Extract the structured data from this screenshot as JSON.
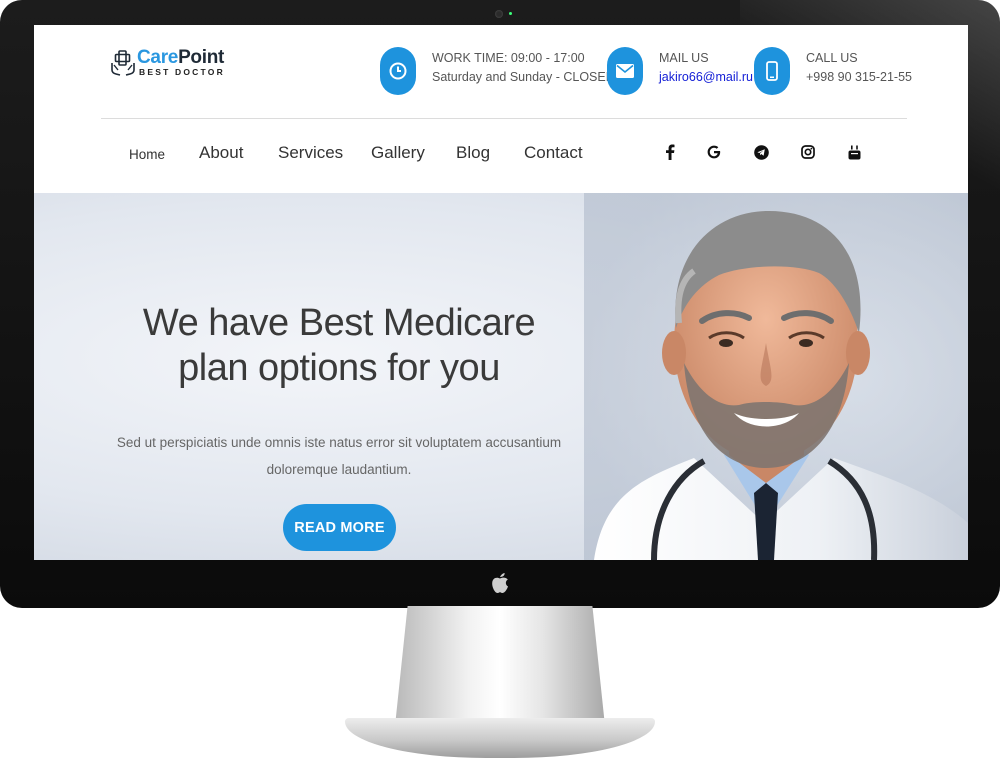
{
  "brand": {
    "name_part1": "Care",
    "name_part2": "Point",
    "tagline": "BEST DOCTOR",
    "accent_color": "#1e93dd"
  },
  "header": {
    "work": {
      "icon": "clock-icon",
      "title": "WORK TIME: 09:00 - 17:00",
      "value": "Saturday and Sunday - CLOSED"
    },
    "mail": {
      "icon": "mail-icon",
      "title": "MAIL US",
      "value": "jakiro66@mail.ru"
    },
    "call": {
      "icon": "phone-icon",
      "title": "CALL US",
      "value": "+998 90 315-21-55"
    }
  },
  "nav": {
    "items": [
      "Home",
      "About",
      "Services",
      "Gallery",
      "Blog",
      "Contact"
    ],
    "active": "Home"
  },
  "social": [
    "facebook-icon",
    "google-icon",
    "telegram-icon",
    "instagram-icon",
    "youtube-icon"
  ],
  "hero": {
    "title_line1": "We have Best Medicare",
    "title_line2": "plan options for you",
    "subtitle_line1": "Sed ut perspiciatis unde omnis iste natus error sit voluptatem accusantium",
    "subtitle_line2": "doloremque laudantium.",
    "button_label": "READ MORE"
  }
}
